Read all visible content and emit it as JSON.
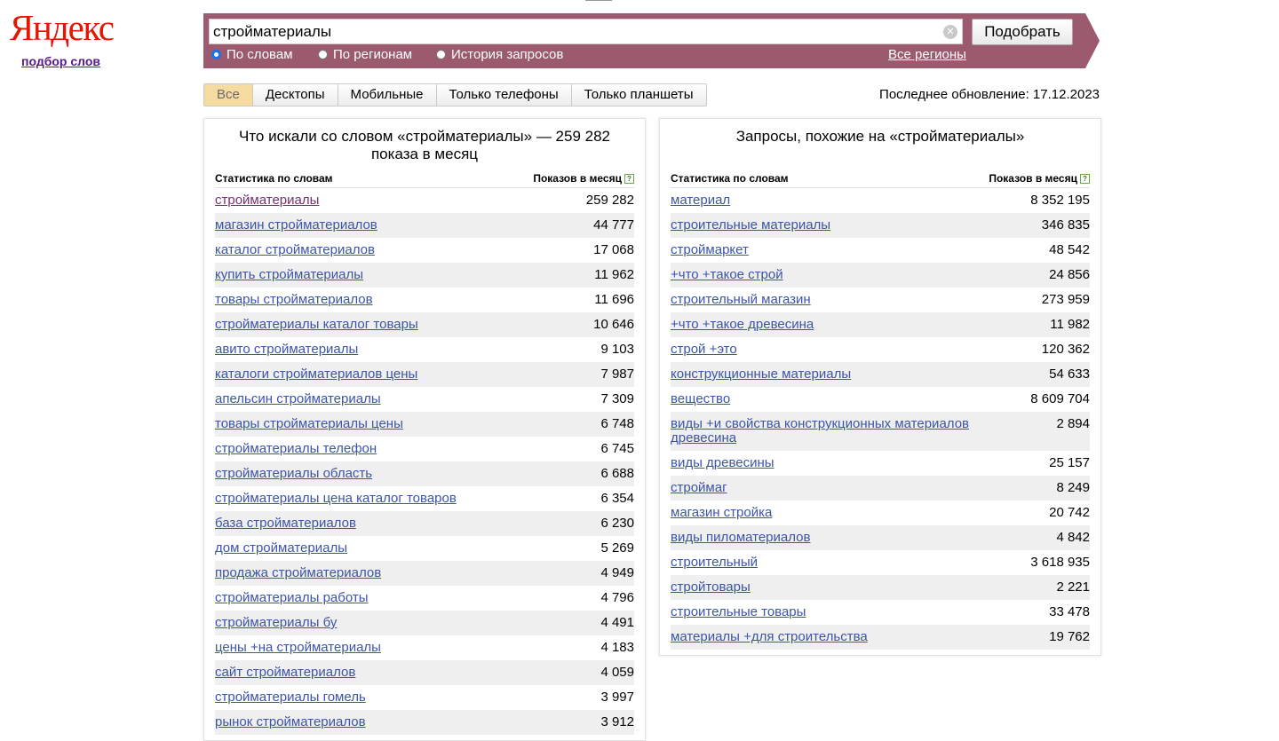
{
  "brand": {
    "logo_text": "Яндекс",
    "sub_link": "подбор слов",
    "accent": "#e61400",
    "bar_color": "#9b5a6e"
  },
  "search": {
    "value": "стройматериалы",
    "submit_label": "Подобрать",
    "modes": [
      {
        "label": "По словам",
        "selected": true
      },
      {
        "label": "По регионам",
        "selected": false
      },
      {
        "label": "История запросов",
        "selected": false
      }
    ],
    "all_regions_label": "Все регионы"
  },
  "tabs": [
    {
      "label": "Все",
      "active": true
    },
    {
      "label": "Десктопы",
      "active": false
    },
    {
      "label": "Мобильные",
      "active": false
    },
    {
      "label": "Только телефоны",
      "active": false
    },
    {
      "label": "Только планшеты",
      "active": false
    }
  ],
  "last_update": "Последнее обновление: 17.12.2023",
  "left_panel": {
    "title": "Что искали со словом «стройматериалы» — 259 282 показа в месяц",
    "col_keyword": "Статистика по словам",
    "col_count": "Показов в месяц",
    "rows": [
      {
        "kw": "стройматериалы",
        "n": "259 282"
      },
      {
        "kw": "магазин стройматериалов",
        "n": "44 777"
      },
      {
        "kw": "каталог стройматериалов",
        "n": "17 068"
      },
      {
        "kw": "купить стройматериалы",
        "n": "11 962"
      },
      {
        "kw": "товары стройматериалов",
        "n": "11 696"
      },
      {
        "kw": "стройматериалы каталог товары",
        "n": "10 646"
      },
      {
        "kw": "авито стройматериалы",
        "n": "9 103"
      },
      {
        "kw": "каталоги стройматериалов цены",
        "n": "7 987"
      },
      {
        "kw": "апельсин стройматериалы",
        "n": "7 309"
      },
      {
        "kw": "товары стройматериалы цены",
        "n": "6 748"
      },
      {
        "kw": "стройматериалы телефон",
        "n": "6 745"
      },
      {
        "kw": "стройматериалы область",
        "n": "6 688"
      },
      {
        "kw": "стройматериалы цена каталог товаров",
        "n": "6 354"
      },
      {
        "kw": "база стройматериалов",
        "n": "6 230"
      },
      {
        "kw": "дом стройматериалы",
        "n": "5 269"
      },
      {
        "kw": "продажа стройматериалов",
        "n": "4 949"
      },
      {
        "kw": "стройматериалы работы",
        "n": "4 796"
      },
      {
        "kw": "стройматериалы бу",
        "n": "4 491"
      },
      {
        "kw": "цены +на стройматериалы",
        "n": "4 183"
      },
      {
        "kw": "сайт стройматериалов",
        "n": "4 059"
      },
      {
        "kw": "стройматериалы гомель",
        "n": "3 997"
      },
      {
        "kw": "рынок стройматериалов",
        "n": "3 912"
      }
    ]
  },
  "right_panel": {
    "title": "Запросы, похожие на «стройматериалы»",
    "col_keyword": "Статистика по словам",
    "col_count": "Показов в месяц",
    "rows": [
      {
        "kw": "материал",
        "n": "8 352 195"
      },
      {
        "kw": "строительные материалы",
        "n": "346 835"
      },
      {
        "kw": "строймаркет",
        "n": "48 542"
      },
      {
        "kw": "+что +такое строй",
        "n": "24 856"
      },
      {
        "kw": "строительный магазин",
        "n": "273 959"
      },
      {
        "kw": "+что +такое древесина",
        "n": "11 982"
      },
      {
        "kw": "строй +это",
        "n": "120 362"
      },
      {
        "kw": "конструкционные материалы",
        "n": "54 633"
      },
      {
        "kw": "вещество",
        "n": "8 609 704"
      },
      {
        "kw": "виды +и свойства конструкционных материалов древесина",
        "n": "2 894"
      },
      {
        "kw": "виды древесины",
        "n": "25 157"
      },
      {
        "kw": "строймаг",
        "n": "8 249"
      },
      {
        "kw": "магазин стройка",
        "n": "20 742"
      },
      {
        "kw": "виды пиломатериалов",
        "n": "4 842"
      },
      {
        "kw": "строительный",
        "n": "3 618 935"
      },
      {
        "kw": "стройтовары",
        "n": "2 221"
      },
      {
        "kw": "строительные товары",
        "n": "33 478"
      },
      {
        "kw": "материалы +для строительства",
        "n": "19 762"
      }
    ]
  }
}
